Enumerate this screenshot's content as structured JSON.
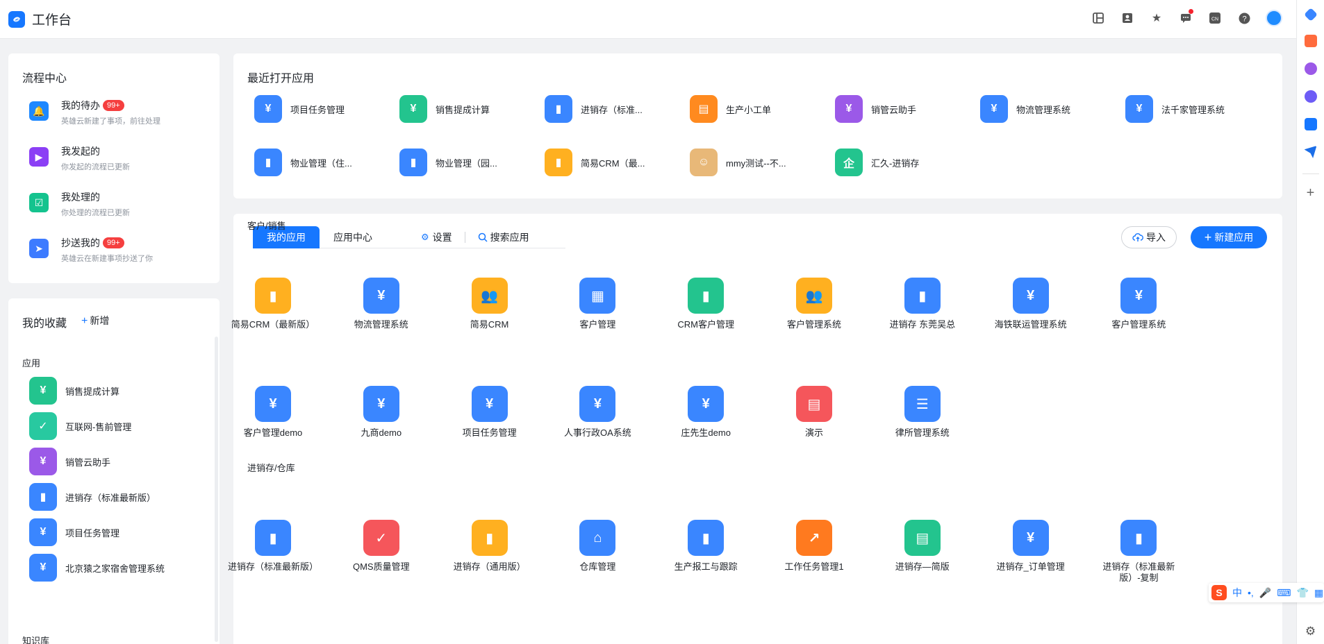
{
  "header": {
    "title": "工作台",
    "icons": [
      "layout-icon",
      "contacts-icon",
      "star-icon",
      "message-icon",
      "language-icon",
      "help-icon",
      "avatar"
    ],
    "language_label": "CN"
  },
  "flow": {
    "title": "流程中心",
    "items": [
      {
        "name": "我的待办",
        "badge": "99+",
        "sub": "英雄云新建了事项，前往处理",
        "color": "#1e88ff",
        "icon": "bell-icon",
        "glyph": "🔔"
      },
      {
        "name": "我发起的",
        "badge": "",
        "sub": "你发起的流程已更新",
        "color": "#8b3ff5",
        "icon": "play-icon",
        "glyph": "▶"
      },
      {
        "name": "我处理的",
        "badge": "",
        "sub": "你处理的流程已更新",
        "color": "#14c38e",
        "icon": "clipboard-icon",
        "glyph": "☑"
      },
      {
        "name": "抄送我的",
        "badge": "99+",
        "sub": "英雄云在新建事项抄送了你",
        "color": "#3d7bff",
        "icon": "send-icon",
        "glyph": "➤"
      }
    ]
  },
  "favorites": {
    "title": "我的收藏",
    "add_label": "新增",
    "section_apps": "应用",
    "section_kb": "知识库",
    "items": [
      {
        "label": "销售提成计算",
        "color": "#23c48e",
        "glyph": "¥"
      },
      {
        "label": "互联网-售前管理",
        "color": "#28c9a0",
        "glyph": "✓"
      },
      {
        "label": "销管云助手",
        "color": "#9b59e8",
        "glyph": "¥"
      },
      {
        "label": "进销存（标准最新版）",
        "color": "#3a86ff",
        "glyph": "▮"
      },
      {
        "label": "项目任务管理",
        "color": "#3a86ff",
        "glyph": "¥"
      },
      {
        "label": "北京猿之家宿舍管理系统",
        "color": "#3a86ff",
        "glyph": "¥"
      }
    ]
  },
  "recent": {
    "title": "最近打开应用",
    "items": [
      {
        "label": "项目任务管理",
        "color": "#3a86ff",
        "glyph": "¥"
      },
      {
        "label": "销售提成计算",
        "color": "#23c48e",
        "glyph": "¥"
      },
      {
        "label": "进销存（标准...",
        "color": "#3a86ff",
        "glyph": "▮"
      },
      {
        "label": "生产小工单",
        "color": "#ff8a1f",
        "glyph": "▤"
      },
      {
        "label": "销管云助手",
        "color": "#9b59e8",
        "glyph": "¥"
      },
      {
        "label": "物流管理系统",
        "color": "#3a86ff",
        "glyph": "¥"
      },
      {
        "label": "法千家管理系统",
        "color": "#3a86ff",
        "glyph": "¥"
      },
      {
        "label": "物业管理（住...",
        "color": "#3a86ff",
        "glyph": "▮"
      },
      {
        "label": "物业管理（园...",
        "color": "#3a86ff",
        "glyph": "▮"
      },
      {
        "label": "简易CRM（最...",
        "color": "#ffb020",
        "glyph": "▮"
      },
      {
        "label": "mmy测试--不...",
        "color": "#e8b878",
        "glyph": "☺"
      },
      {
        "label": "汇久-进销存",
        "color": "#23c48e",
        "glyph": "企"
      }
    ]
  },
  "apps": {
    "tab_my": "我的应用",
    "tab_center": "应用中心",
    "settings": "设置",
    "search": "搜索应用",
    "import": "导入",
    "new_app": "新建应用",
    "groups": [
      {
        "title": "客户/销售",
        "rows": [
          [
            {
              "label": "简易CRM（最新版）",
              "color": "#ffb020",
              "glyph": "▮"
            },
            {
              "label": "物流管理系统",
              "color": "#3a86ff",
              "glyph": "¥"
            },
            {
              "label": "简易CRM",
              "color": "#ffb020",
              "glyph": "👥"
            },
            {
              "label": "客户管理",
              "color": "#3a86ff",
              "glyph": "▦"
            },
            {
              "label": "CRM客户管理",
              "color": "#23c48e",
              "glyph": "▮"
            },
            {
              "label": "客户管理系统",
              "color": "#ffb020",
              "glyph": "👥"
            },
            {
              "label": "进销存 东莞吴总",
              "color": "#3a86ff",
              "glyph": "▮"
            },
            {
              "label": "海铁联运管理系统",
              "color": "#3a86ff",
              "glyph": "¥"
            },
            {
              "label": "客户管理系统",
              "color": "#3a86ff",
              "glyph": "¥"
            }
          ],
          [
            {
              "label": "客户管理demo",
              "color": "#3a86ff",
              "glyph": "¥"
            },
            {
              "label": "九商demo",
              "color": "#3a86ff",
              "glyph": "¥"
            },
            {
              "label": "项目任务管理",
              "color": "#3a86ff",
              "glyph": "¥"
            },
            {
              "label": "人事行政OA系统",
              "color": "#3a86ff",
              "glyph": "¥"
            },
            {
              "label": "庄先生demo",
              "color": "#3a86ff",
              "glyph": "¥"
            },
            {
              "label": "演示",
              "color": "#f5565b",
              "glyph": "▤"
            },
            {
              "label": "律所管理系统",
              "color": "#3a86ff",
              "glyph": "☰"
            }
          ]
        ]
      },
      {
        "title": "进销存/仓库",
        "rows": [
          [
            {
              "label": "进销存（标准最新版）",
              "color": "#3a86ff",
              "glyph": "▮"
            },
            {
              "label": "QMS质量管理",
              "color": "#f5565b",
              "glyph": "✓"
            },
            {
              "label": "进销存（通用版）",
              "color": "#ffb020",
              "glyph": "▮"
            },
            {
              "label": "仓库管理",
              "color": "#3a86ff",
              "glyph": "⌂"
            },
            {
              "label": "生产报工与跟踪",
              "color": "#3a86ff",
              "glyph": "▮"
            },
            {
              "label": "工作任务管理1",
              "color": "#ff7a1f",
              "glyph": "↗"
            },
            {
              "label": "进销存—简版",
              "color": "#23c48e",
              "glyph": "▤"
            },
            {
              "label": "进销存_订单管理",
              "color": "#3a86ff",
              "glyph": "¥"
            },
            {
              "label": "进销存（标准最新版）-复制",
              "color": "#3a86ff",
              "glyph": "▮"
            }
          ]
        ]
      }
    ]
  },
  "ime": {
    "label": "中"
  }
}
